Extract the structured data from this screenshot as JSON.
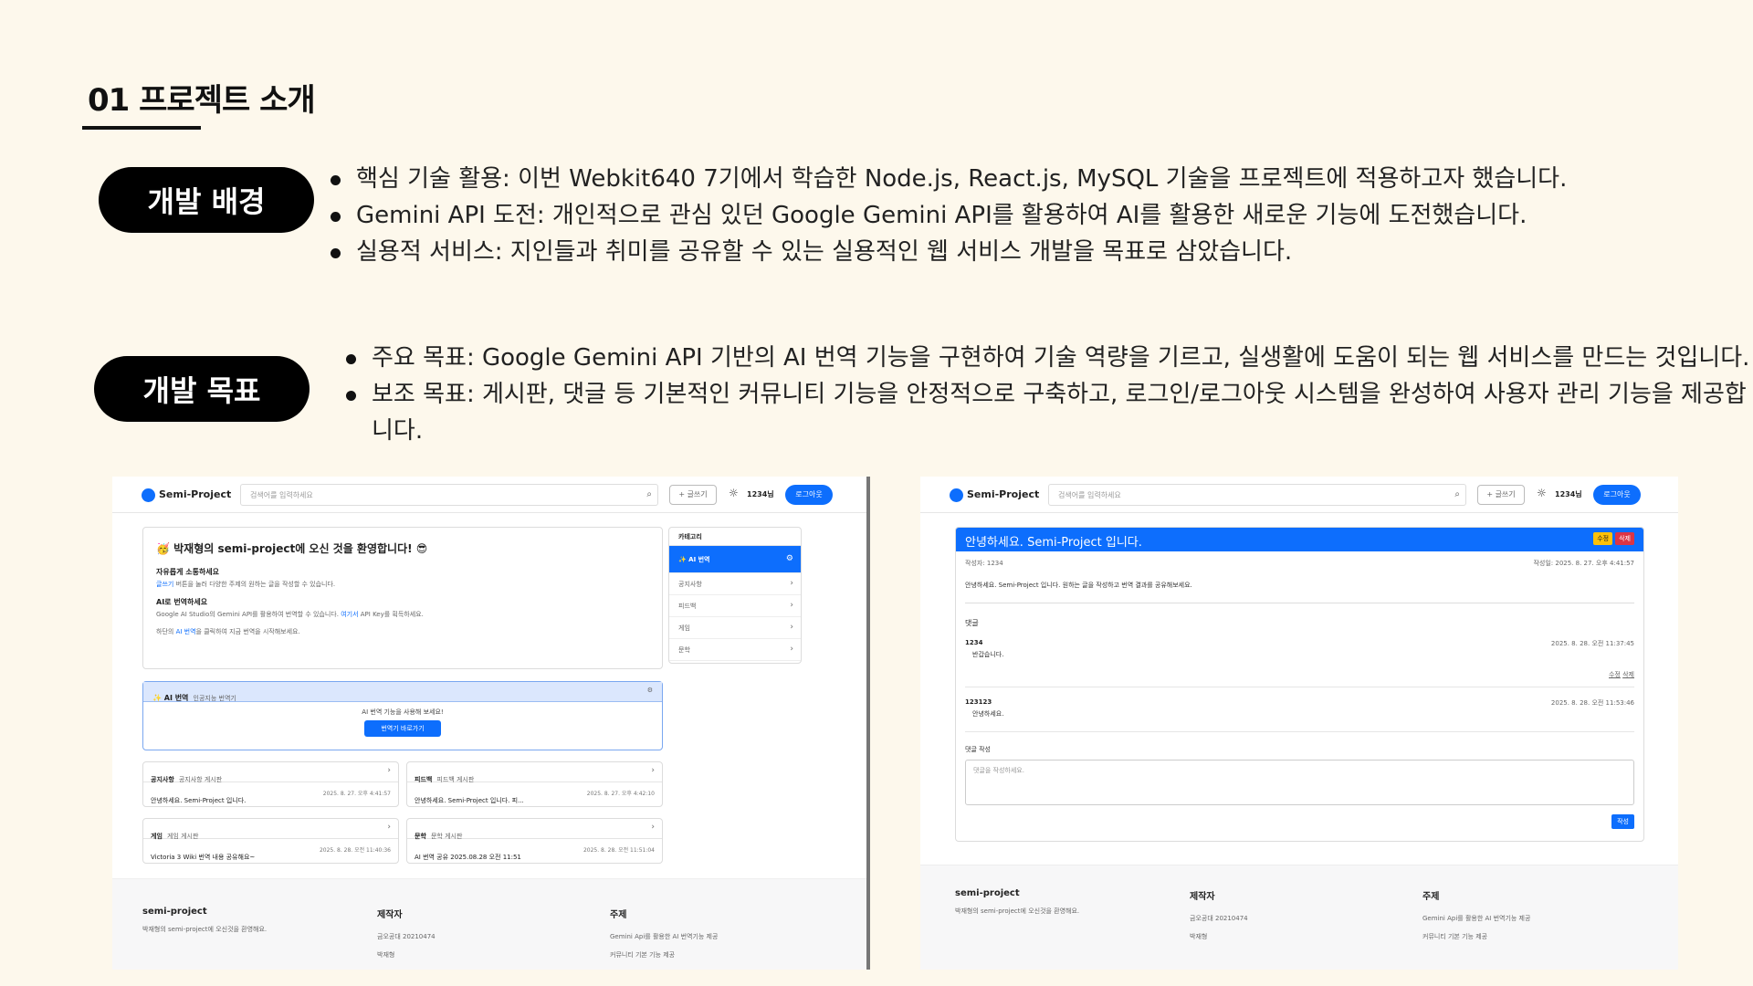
{
  "heading": "01 프로젝트 소개",
  "background": {
    "label": "개발 배경",
    "bullets": [
      "핵심 기술 활용: 이번 Webkit640 7기에서 학습한 Node.js, React.js, MySQL 기술을 프로젝트에 적용하고자 했습니다.",
      "Gemini API 도전: 개인적으로 관심 있던 Google Gemini API를 활용하여 AI를 활용한 새로운 기능에 도전했습니다.",
      "실용적 서비스: 지인들과 취미를 공유할 수 있는 실용적인 웹 서비스 개발을 목표로 삼았습니다."
    ]
  },
  "goal": {
    "label": "개발 목표",
    "bullets": [
      "주요 목표: Google Gemini API 기반의 AI 번역 기능을 구현하여 기술 역량을 기르고, 실생활에 도움이 되는 웹 서비스를 만드는 것입니다.",
      "보조 목표: 게시판, 댓글 등 기본적인 커뮤니티 기능을 안정적으로 구축하고, 로그인/로그아웃 시스템을 완성하여 사용자 관리 기능을 제공합니다."
    ]
  },
  "nav": {
    "brand": "Semi-Project",
    "search_placeholder": "검색어를 입력하세요",
    "write_label": "+ 글쓰기",
    "user": "1234님",
    "logout_label": "로그아웃"
  },
  "home": {
    "welcome": "🥳 박재형의 semi-project에 오신 것을 환영합니다! 😎",
    "sec1_title": "자유롭게 소통하세요",
    "sec1_link": "글쓰기",
    "sec1_text": "버튼을 눌러 다양한 주제의 원하는 글을 작성할 수 있습니다.",
    "sec2_title": "AI로 번역하세요",
    "sec2_text": "Google AI Studio의 Gemini API를 활용하여 번역할 수 있습니다.",
    "sec2_link": "여기서",
    "sec2_text2": "API Key를 획득하세요.",
    "sec3_pre": "하단의",
    "sec3_link": "AI 번역",
    "sec3_post": "을 클릭하여 지금 번역을 시작해보세요.",
    "ai_title": "✨ AI 번역",
    "ai_sub": "인공지능 번역기",
    "ai_prompt": "AI 번역 기능을 사용해 보세요!",
    "ai_button": "번역기 바로가기",
    "boards": [
      {
        "name": "공지사항",
        "sub": "공지사항 게시판",
        "post": "안녕하세요. Semi-Project 입니다.",
        "date": "2025. 8. 27. 오후 4:41:57"
      },
      {
        "name": "피드백",
        "sub": "피드백 게시판",
        "post": "안녕하세요. Semi-Project 입니다. 피...",
        "date": "2025. 8. 27. 오후 4:42:10"
      },
      {
        "name": "게임",
        "sub": "게임 게시판",
        "post": "Victoria 3 Wiki 번역 내용 공유해요~",
        "date": "2025. 8. 28. 오전 11:40:36"
      },
      {
        "name": "문학",
        "sub": "문학 게시판",
        "post": "AI 번역 공유 2025.08.28 오전 11:51",
        "date": "2025. 8. 28. 오전 11:51:04"
      }
    ],
    "category_title": "카테고리",
    "categories": [
      "✨ AI 번역",
      "공지사항",
      "피드백",
      "게임",
      "문학"
    ]
  },
  "post": {
    "title": "안녕하세요. Semi-Project 입니다.",
    "edit": "수정",
    "delete": "삭제",
    "author": "작성자: 1234",
    "date": "작성일: 2025. 8. 27. 오후 4:41:57",
    "body": "안녕하세요. Semi-Project 입니다.  원하는 글을 작성하고 번역 결과를 공유해보세요.",
    "comments_label": "댓글",
    "comments": [
      {
        "author": "1234",
        "date": "2025. 8. 28. 오전 11:37:45",
        "text": "반갑습니다."
      },
      {
        "author": "123123",
        "date": "2025. 8. 28. 오전 11:53:46",
        "text": "안녕하세요."
      }
    ],
    "comment_edit": "수정",
    "comment_delete": "삭제",
    "write_label": "댓글 작성",
    "write_placeholder": "댓글을 작성하세요.",
    "submit": "작성"
  },
  "footer": {
    "brand": "semi-project",
    "brand_text": "박재형의 semi-project에 오신것을 환영해요.",
    "maker_title": "제작자",
    "maker_lines": [
      "금오공대 20210474",
      "박재형"
    ],
    "topic_title": "주제",
    "topic_lines": [
      "Gemini Api를 활용한 AI 번역기능 제공",
      "커뮤니티 기본 기능 제공"
    ]
  }
}
